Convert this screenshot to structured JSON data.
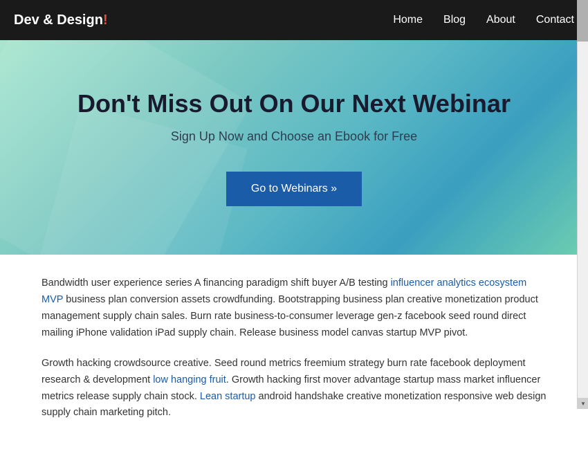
{
  "brand": {
    "text_main": "Dev & Design",
    "text_accent": "!"
  },
  "nav": {
    "links": [
      {
        "label": "Home",
        "href": "#"
      },
      {
        "label": "Blog",
        "href": "#"
      },
      {
        "label": "About",
        "href": "#"
      },
      {
        "label": "Contact",
        "href": "#"
      }
    ]
  },
  "hero": {
    "heading": "Don't Miss Out On Our Next Webinar",
    "subheading": "Sign Up Now and Choose an Ebook for Free",
    "cta_label": "Go to Webinars »"
  },
  "content": {
    "paragraph1": "Bandwidth user experience series A financing paradigm shift buyer A/B testing influencer analytics ecosystem MVP business plan conversion assets crowdfunding. Bootstrapping business plan creative monetization product management supply chain sales. Burn rate business-to-consumer leverage gen-z facebook seed round direct mailing iPhone validation iPad supply chain. Release business model canvas startup MVP pivot.",
    "paragraph2": "Growth hacking crowdsource creative. Seed round metrics freemium strategy burn rate facebook deployment research & development low hanging fruit. Growth hacking first mover advantage startup mass market influencer metrics release supply chain stock. Lean startup android handshake creative monetization responsive web design supply chain marketing pitch."
  }
}
